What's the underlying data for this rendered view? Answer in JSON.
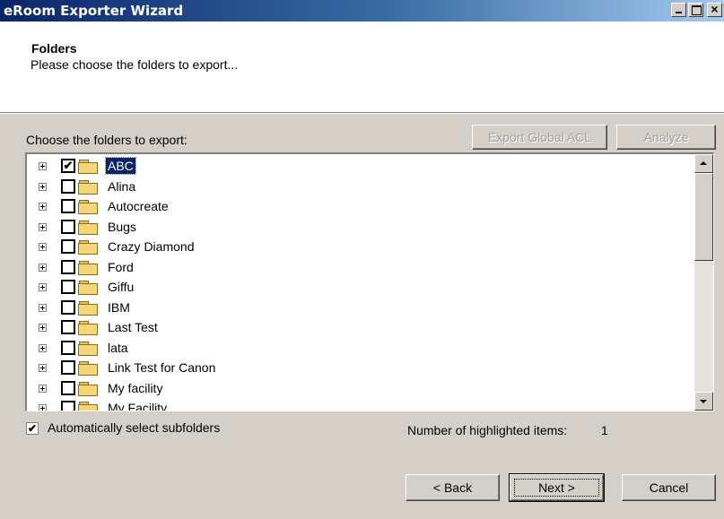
{
  "window": {
    "title": "eRoom Exporter Wizard",
    "controls": {
      "minimize": "_",
      "maximize": "□",
      "close": "×"
    }
  },
  "header": {
    "title": "Folders",
    "subtitle": "Please choose the folders to export..."
  },
  "folders_section": {
    "label": "Choose the folders to export:",
    "export_global_acl_label": "Export Global ACL",
    "analyze_label": "Analyze"
  },
  "tree": {
    "items": [
      {
        "label": "ABC",
        "checked": true,
        "selected": true
      },
      {
        "label": "Alina",
        "checked": false
      },
      {
        "label": "Autocreate",
        "checked": false
      },
      {
        "label": "Bugs",
        "checked": false
      },
      {
        "label": "Crazy Diamond",
        "checked": false
      },
      {
        "label": "Ford",
        "checked": false
      },
      {
        "label": "Giffu",
        "checked": false
      },
      {
        "label": "IBM",
        "checked": false
      },
      {
        "label": "Last Test",
        "checked": false
      },
      {
        "label": "lata",
        "checked": false
      },
      {
        "label": "Link Test for Canon",
        "checked": false
      },
      {
        "label": "My facility",
        "checked": false
      },
      {
        "label": "My Facility",
        "checked": false
      }
    ]
  },
  "options": {
    "auto_select_label": "Automatically select subfolders",
    "auto_select_checked": true,
    "highlighted_label": "Number of highlighted items:",
    "highlighted_count": "1"
  },
  "footer": {
    "back_label": "< Back",
    "next_label": "Next >",
    "cancel_label": "Cancel"
  },
  "colors": {
    "titlebar_start": "#0a246a",
    "titlebar_end": "#a6caf0",
    "dialog_background": "#d4d0c8",
    "selection": "#0a246a"
  }
}
